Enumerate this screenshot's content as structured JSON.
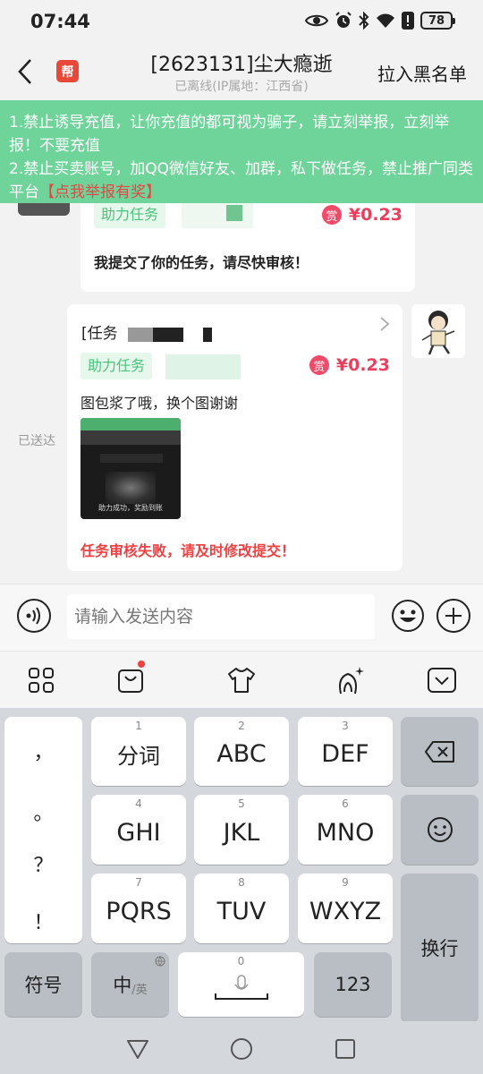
{
  "status_bar": {
    "time": "07:44",
    "battery": "78"
  },
  "header": {
    "title": "[2623131]尘大瘾逝",
    "subtitle": "已离线(IP属地：江西省)",
    "blacklist_label": "拉入黑名单",
    "badge_text": "帮"
  },
  "notice": {
    "line1": "1.禁止诱导充值，让你充值的都可视为骗子，请立刻举报，立刻举报！不要充值",
    "line2": "2.禁止买卖账号，加QQ微信好友、加群，私下做任务，禁止推广同类平台",
    "report_link": "【点我举报有奖】"
  },
  "messages": [
    {
      "tag": "助力任务",
      "reward_badge": "赏",
      "reward": "¥0.23",
      "text": "我提交了你的任务，请尽快审核！"
    },
    {
      "task_title": "[任务",
      "tag": "助力任务",
      "reward_badge": "赏",
      "reward": "¥0.23",
      "text": "图包浆了哦，换个图谢谢",
      "thumb_caption": "助力成功，奖励到账",
      "status": "任务审核失败，请及时修改提交！",
      "sent_label": "已送达"
    }
  ],
  "input": {
    "placeholder": "请输入发送内容"
  },
  "keyboard": {
    "punct": [
      "，",
      "。",
      "？",
      "！"
    ],
    "row1": [
      {
        "num": "1",
        "label": "分词"
      },
      {
        "num": "2",
        "label": "ABC"
      },
      {
        "num": "3",
        "label": "DEF"
      }
    ],
    "row2": [
      {
        "num": "4",
        "label": "GHI"
      },
      {
        "num": "5",
        "label": "JKL"
      },
      {
        "num": "6",
        "label": "MNO"
      }
    ],
    "row3": [
      {
        "num": "7",
        "label": "PQRS"
      },
      {
        "num": "8",
        "label": "TUV"
      },
      {
        "num": "9",
        "label": "WXYZ"
      }
    ],
    "symbols": "符号",
    "lang_main": "中",
    "lang_alt": "/英",
    "space_num": "0",
    "numbers": "123",
    "enter": "换行"
  },
  "colors": {
    "notice_bg": "#6fd49a",
    "reward": "#ee3e5b",
    "tag_text": "#49c47a",
    "fail": "#f04040"
  }
}
